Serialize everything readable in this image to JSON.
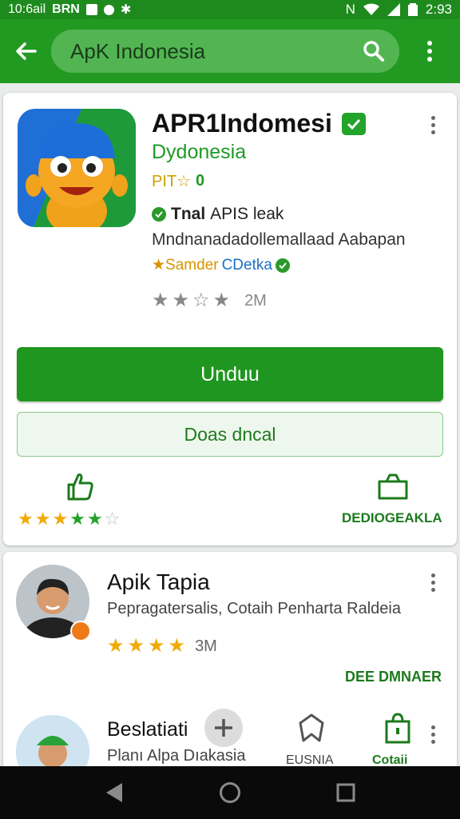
{
  "status_bar": {
    "left_text": "10:6ail",
    "carrier": "BRN",
    "time": "2:93",
    "nfc_text": "N"
  },
  "app_bar": {
    "search_value": "ApK Indonesia"
  },
  "app": {
    "title": "APR1Indomesi",
    "developer": "Dydonesia",
    "rating_prefix": "PIT☆",
    "rating_value": "0",
    "feature_bold": "Tnal",
    "feature_text": "APIS leak",
    "description": "Mndnanadadollemallaad Aabapan",
    "tag1": "★Samder",
    "tag2": "CDetka",
    "downloads": "2M",
    "install_label": "Unduu",
    "secondary_label": "Doas dncal",
    "category_label": "DEDIOGEAKLA"
  },
  "list": [
    {
      "title": "Apik Tapia",
      "subtitle": "Pepragatersalis, Cotaih Penharta Raldeia",
      "rating_count": "3M",
      "action_label": "DEE DMNAER"
    },
    {
      "title": "Beslatiati",
      "subtitle": "Planı Alpa Dıakasia",
      "label1": "EUSNIA",
      "label2": "Cotaii"
    }
  ],
  "colors": {
    "primary": "#229a22",
    "status_bar": "#1e8a1e",
    "star_gold": "#f2a900",
    "star_green": "#22a32a"
  }
}
